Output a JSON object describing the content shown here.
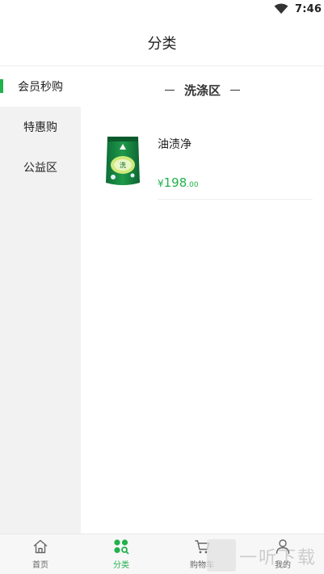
{
  "status_bar": {
    "time": "7:46",
    "wifi_icon": "wifi-icon"
  },
  "header": {
    "title": "分类"
  },
  "sidebar": {
    "items": [
      {
        "label": "会员秒购",
        "active": true
      },
      {
        "label": "特惠购",
        "active": false
      },
      {
        "label": "公益区",
        "active": false
      }
    ]
  },
  "section": {
    "title": "洗涤区"
  },
  "product": {
    "name": "油渍净",
    "currency": "¥",
    "price_int": "198",
    "price_dec": ".00",
    "image_icon": "detergent-bag-icon"
  },
  "tabbar": {
    "tabs": [
      {
        "label": "首页",
        "icon": "home-icon",
        "active": false
      },
      {
        "label": "分类",
        "icon": "category-icon",
        "active": true
      },
      {
        "label": "购物车",
        "icon": "cart-icon",
        "active": false
      },
      {
        "label": "我的",
        "icon": "user-icon",
        "active": false
      }
    ]
  },
  "watermark": {
    "text": "一听下载"
  },
  "colors": {
    "accent": "#22b14c",
    "sidebar_bg": "#f2f2f2",
    "tabbar_bg": "#f7f7f7"
  }
}
